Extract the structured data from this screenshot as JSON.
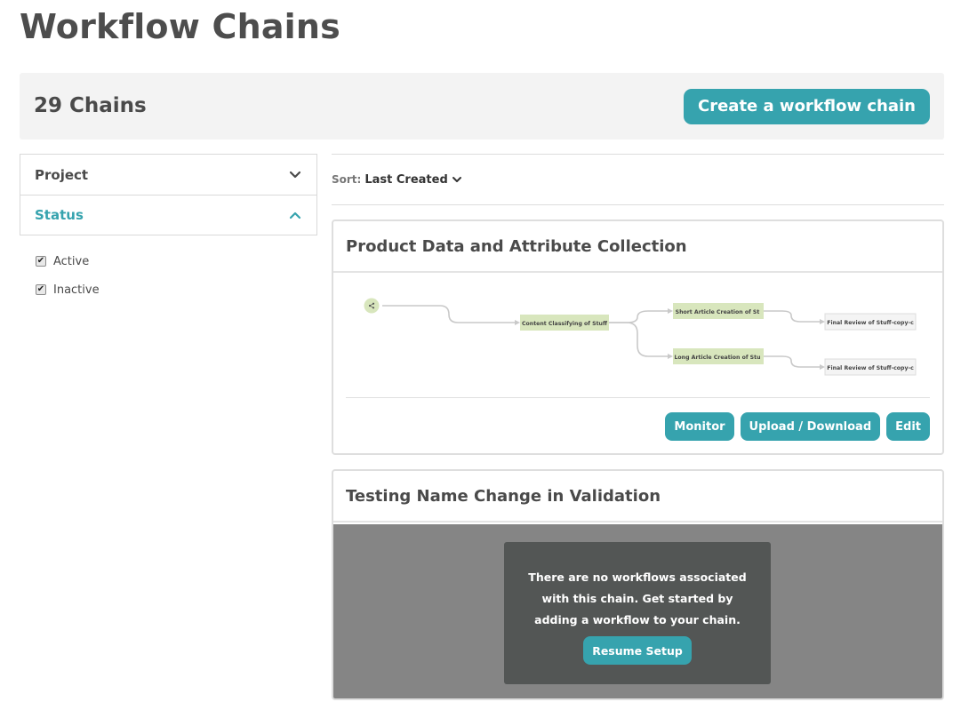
{
  "page": {
    "title": "Workflow Chains"
  },
  "summary": {
    "count_label": "29 Chains",
    "create_label": "Create a workflow chain"
  },
  "filters": {
    "project_label": "Project",
    "status_label": "Status",
    "options": [
      {
        "label": "Active",
        "checked": true
      },
      {
        "label": "Inactive",
        "checked": true
      }
    ]
  },
  "sort": {
    "label": "Sort:",
    "value": "Last Created"
  },
  "chains": [
    {
      "title": "Product Data and Attribute Collection",
      "diagram": {
        "nodes": [
          "Content Classifying of Stuff",
          "Short Article Creation of St",
          "Long Article Creation of Stu",
          "Final Review of Stuff-copy-c",
          "Final Review of Stuff-copy-c"
        ]
      },
      "actions": {
        "monitor": "Monitor",
        "upload": "Upload / Download",
        "edit": "Edit"
      }
    },
    {
      "title": "Testing Name Change in Validation",
      "empty_message": "There are no workflows associated with this chain. Get started by adding a workflow to your chain.",
      "resume_label": "Resume Setup"
    }
  ],
  "colors": {
    "accent": "#36a3ae",
    "node_fill": "#d8e6bd",
    "final_node_fill": "#f4f4f4",
    "empty_overlay": "#858585"
  }
}
